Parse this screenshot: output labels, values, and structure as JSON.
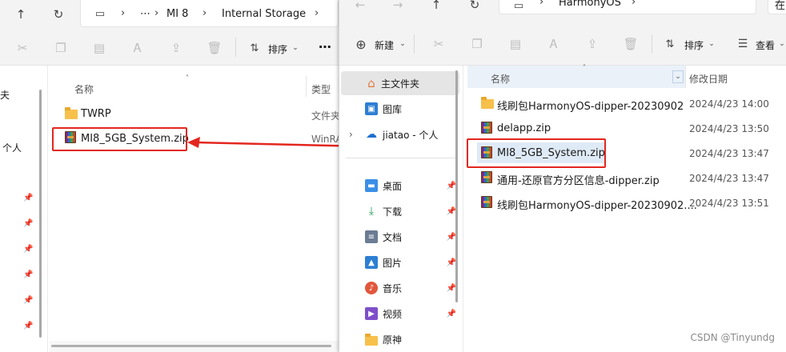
{
  "left_window": {
    "breadcrumb": [
      "MI 8",
      "Internal Storage"
    ],
    "ellipsis": "⋯",
    "toolbar": {
      "sort_label": "排序",
      "more": "⋯"
    },
    "nav_fragments": [
      "夫",
      "个人"
    ],
    "columns": {
      "name": "名称",
      "type": "类型"
    },
    "rows": [
      {
        "name": "TWRP",
        "type": "文件夹",
        "icon": "folder-icon"
      },
      {
        "name": "MI8_5GB_System.zip",
        "type": "WinRA",
        "icon": "rar-archive-icon"
      }
    ]
  },
  "right_window": {
    "breadcrumb": [
      "HarmonyOS"
    ],
    "search_fragment": "在",
    "toolbar": {
      "new_label": "新建",
      "sort_label": "排序",
      "view_label": "查看"
    },
    "nav": {
      "home": "主文件夹",
      "gallery": "图库",
      "onedrive": "jiatao - 个人",
      "pinned": [
        {
          "label": "桌面",
          "icon": "desktop-icon",
          "color": "#3a8ee6"
        },
        {
          "label": "下载",
          "icon": "download-icon",
          "color": "#2a9d5c"
        },
        {
          "label": "文档",
          "icon": "document-icon",
          "color": "#6b7c93"
        },
        {
          "label": "图片",
          "icon": "pictures-icon",
          "color": "#2d7fd3"
        },
        {
          "label": "音乐",
          "icon": "music-icon",
          "color": "#e2573c"
        },
        {
          "label": "视频",
          "icon": "video-icon",
          "color": "#7e4fc9"
        },
        {
          "label": "原神",
          "icon": "folder-icon",
          "color": "#f7c04a"
        }
      ]
    },
    "columns": {
      "name": "名称",
      "date": "修改日期"
    },
    "rows": [
      {
        "name": "线刷包HarmonyOS-dipper-20230902",
        "date": "2024/4/23 14:00",
        "icon": "folder-icon"
      },
      {
        "name": "delapp.zip",
        "date": "2024/4/23 13:50",
        "icon": "rar-archive-icon"
      },
      {
        "name": "MI8_5GB_System.zip",
        "date": "2024/4/23 13:47",
        "icon": "rar-archive-icon"
      },
      {
        "name": "通用-还原官方分区信息-dipper.zip",
        "date": "2024/4/23 13:47",
        "icon": "rar-archive-icon"
      },
      {
        "name": "线刷包HarmonyOS-dipper-20230902....",
        "date": "2024/4/23 13:51",
        "icon": "rar-archive-icon"
      }
    ]
  },
  "watermark": "CSDN @Tinyundg",
  "colors": {
    "annotation": "#e3271f",
    "selection": "#dfeaf7"
  }
}
